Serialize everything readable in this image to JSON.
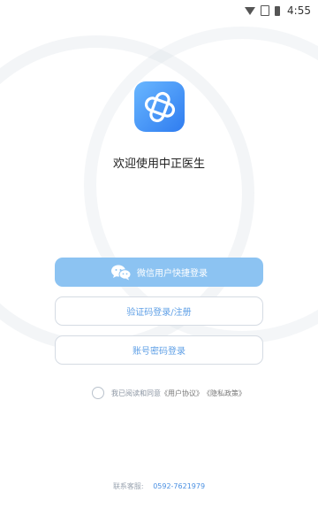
{
  "status_bar": {
    "time": "4:55"
  },
  "app": {
    "welcome": "欢迎使用中正医生"
  },
  "buttons": {
    "wechat_login": "微信用户快捷登录",
    "sms_login": "验证码登录/注册",
    "password_login": "账号密码登录"
  },
  "agreement": {
    "prefix": "我已阅读和同意",
    "user_agreement": "《用户协议》",
    "privacy_policy": "《隐私政策》"
  },
  "contact": {
    "label": "联系客服:",
    "phone": "0592-7621979"
  },
  "colors": {
    "accent": "#8cc3f2",
    "link_blue": "#5e9fe6",
    "logo_gradient_start": "#69b7ff",
    "logo_gradient_end": "#2f7cf0"
  }
}
